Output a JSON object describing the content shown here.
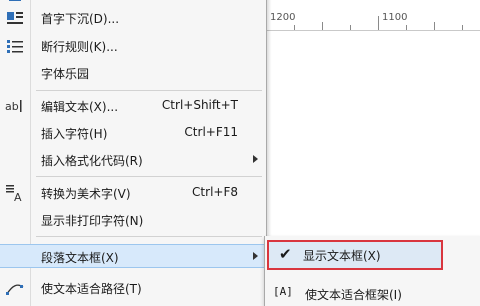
{
  "ruler": {
    "labels": [
      "1200",
      "1100"
    ]
  },
  "menu": {
    "items": [
      {
        "label": "首字下沉(D)...",
        "icon": "drop-cap-icon"
      },
      {
        "label": "断行规则(K)...",
        "icon": "line-break-rules-icon"
      },
      {
        "label": "字体乐园",
        "icon": ""
      },
      {
        "label": "编辑文本(X)...",
        "shortcut": "Ctrl+Shift+T",
        "icon": "edit-text-icon"
      },
      {
        "label": "插入字符(H)",
        "shortcut": "Ctrl+F11"
      },
      {
        "label": "插入格式化代码(R)",
        "submenu": true
      },
      {
        "label": "转换为美术字(V)",
        "shortcut": "Ctrl+F8",
        "icon": "convert-artistic-icon"
      },
      {
        "label": "显示非打印字符(N)"
      },
      {
        "label": "段落文本框(X)",
        "submenu": true,
        "active": true
      },
      {
        "label": "使文本适合路径(T)",
        "icon": "fit-text-to-path-icon"
      }
    ]
  },
  "submenu": {
    "items": [
      {
        "label": "显示文本框(X)",
        "checked": true
      },
      {
        "label": "使文本适合框架(I)",
        "icon_text": "[A]"
      }
    ]
  }
}
